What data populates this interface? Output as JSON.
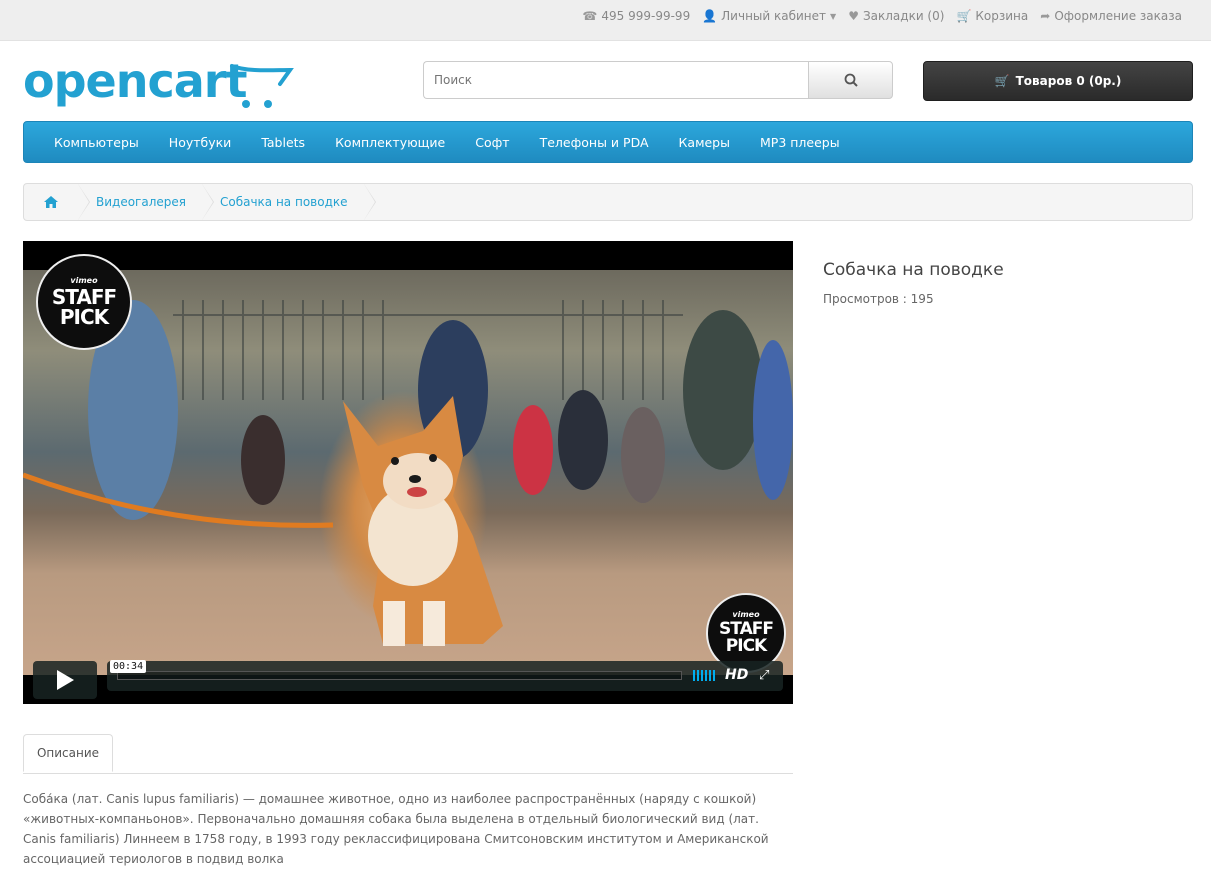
{
  "topbar": {
    "phone": "495 999-99-99",
    "account": "Личный кабинет",
    "wishlist": "Закладки (0)",
    "cart": "Корзина",
    "checkout": "Оформление заказа"
  },
  "logo": {
    "text": "opencart"
  },
  "search": {
    "placeholder": "Поиск"
  },
  "cart_button": {
    "label": "Товаров 0 (0р.)"
  },
  "menu": {
    "items": [
      "Компьютеры",
      "Ноутбуки",
      "Tablets",
      "Комплектующие",
      "Софт",
      "Телефоны и PDA",
      "Камеры",
      "MP3 плееры"
    ]
  },
  "breadcrumb": {
    "items": [
      "Видеогалерея",
      "Собачка на поводке"
    ]
  },
  "video": {
    "badge_top": "vimeo",
    "badge_line1": "STAFF",
    "badge_line2": "PICK",
    "time": "00:34",
    "hd": "HD"
  },
  "product": {
    "title": "Собачка на поводке",
    "views": "Просмотров : 195"
  },
  "tabs": {
    "description": "Описание"
  },
  "description": {
    "text": "Соба́ка (лат. Canis lupus familiaris) — домашнее животное, одно из наиболее распространённых (наряду с кошкой) «животных-компаньонов». Первоначально домашняя собака была выделена в отдельный биологический вид (лат. Canis familiaris) Линнеем в 1758 году, в 1993 году реклассифицирована Смитсоновским институтом и Американской ассоциацией териологов в подвид волка"
  },
  "colors": {
    "brand": "#23a1d1",
    "menu": "#229ac8",
    "cart_button": "#363636"
  }
}
